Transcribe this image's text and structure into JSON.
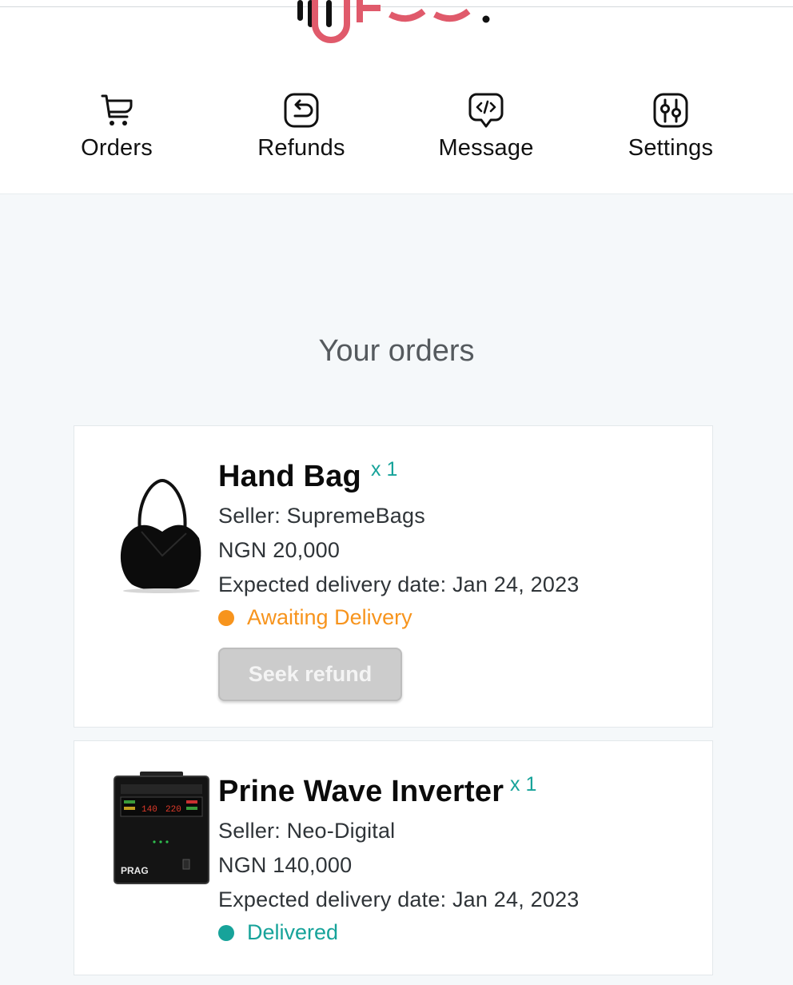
{
  "nav": {
    "items": [
      {
        "label": "Orders",
        "icon": "cart-icon"
      },
      {
        "label": "Refunds",
        "icon": "refund-icon"
      },
      {
        "label": "Message",
        "icon": "message-icon"
      },
      {
        "label": "Settings",
        "icon": "settings-icon"
      }
    ]
  },
  "page_title": "Your orders",
  "orders": [
    {
      "name": "Hand Bag",
      "qty": "x 1",
      "seller": "Seller: SupremeBags",
      "price": "NGN 20,000",
      "delivery": "Expected delivery date: Jan 24, 2023",
      "status": "Awaiting Delivery",
      "status_color": "#f7941d",
      "action_label": "Seek refund"
    },
    {
      "name": "Prine Wave Inverter",
      "qty": "x 1",
      "seller": "Seller: Neo-Digital",
      "price": "NGN 140,000",
      "delivery": "Expected delivery date: Jan 24, 2023",
      "status": "Delivered",
      "status_color": "#17a39a",
      "product_brand": "PRAG",
      "display_left": "140",
      "display_right": "220"
    }
  ],
  "colors": {
    "brand": "#e05a6b",
    "accent_teal": "#17a39a",
    "awaiting": "#f7941d"
  }
}
